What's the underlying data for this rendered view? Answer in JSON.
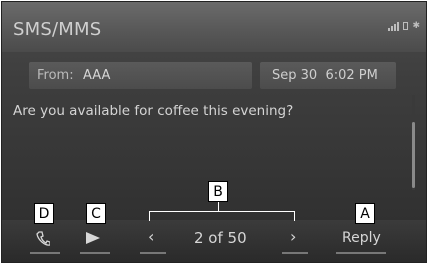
{
  "header": {
    "title": "SMS/MMS"
  },
  "message": {
    "from_label": "From:",
    "from_value": "AAA",
    "date": "Sep 30",
    "time": "6:02 PM",
    "body": "Are you available for coffee this evening?"
  },
  "controls": {
    "call_icon": "phone-icon",
    "play_icon": "play-icon",
    "prev_icon": "chevron-left-icon",
    "next_icon": "chevron-right-icon",
    "page_indicator": "2 of 50",
    "reply_label": "Reply"
  },
  "callouts": {
    "a": "A",
    "b": "B",
    "c": "C",
    "d": "D"
  }
}
